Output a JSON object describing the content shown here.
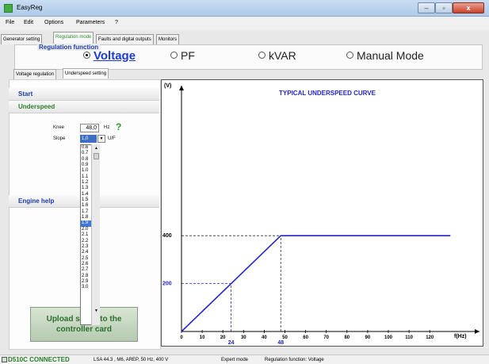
{
  "window": {
    "title": "EasyReg"
  },
  "menu": [
    "File",
    "Edit",
    "Options",
    "Parameters",
    "?"
  ],
  "main_tabs": [
    "Generator setting",
    "Regulation mode",
    "Faults and digital outputs",
    "Monitors"
  ],
  "regulation_function": {
    "title": "Regulation function",
    "options": [
      "Voltage",
      "PF",
      "kVAR",
      "Manual Mode"
    ],
    "selected": "Voltage"
  },
  "sub_tabs": [
    "Voltage regulation",
    "Underspeed setting"
  ],
  "left_pane": {
    "start": "Start",
    "underspeed": "Underspeed",
    "knee_label": "Knee",
    "knee_value": "48,0",
    "knee_unit": "Hz",
    "help_mark": "?",
    "slope_label": "Slope",
    "slope_value": "1,0",
    "slope_unit": "U/F",
    "engine_help": "Engine help",
    "upload_line1": "Upload s",
    "upload_line1_tail": "s to the",
    "upload_line2": "controller card"
  },
  "slope_options": [
    "0.6",
    "0.7",
    "0.8",
    "0.9",
    "1.0",
    "1.1",
    "1.2",
    "1.3",
    "1.4",
    "1.5",
    "1.6",
    "1.7",
    "1.8",
    "1.9",
    "2.0",
    "2.1",
    "2.2",
    "2.3",
    "2.4",
    "2.5",
    "2.6",
    "2.7",
    "2.8",
    "2.9",
    "3.0"
  ],
  "slope_highlighted": "1.9",
  "chart_data": {
    "type": "line",
    "title": "TYPICAL UNDERSPEED CURVE",
    "xlabel": "f(Hz)",
    "ylabel": "(V)",
    "xlim": [
      0,
      130
    ],
    "ylim": [
      0,
      450
    ],
    "x_ticks": [
      0,
      10,
      20,
      30,
      40,
      50,
      60,
      70,
      80,
      90,
      100,
      110,
      120
    ],
    "x_tick_labels": [
      "0",
      "10",
      "20",
      "30",
      "40",
      "50",
      "60",
      "70",
      "80",
      "90",
      "100",
      "110",
      "120"
    ],
    "y_marks": [
      400,
      200
    ],
    "x_marks": [
      24,
      48
    ],
    "series": [
      {
        "x": [
          0,
          48,
          130
        ],
        "y": [
          0,
          400,
          400
        ]
      }
    ],
    "guides": [
      {
        "from": [
          0,
          400
        ],
        "to": [
          48,
          400
        ]
      },
      {
        "from": [
          48,
          0
        ],
        "to": [
          48,
          400
        ]
      },
      {
        "from": [
          0,
          200
        ],
        "to": [
          24,
          200
        ]
      },
      {
        "from": [
          24,
          0
        ],
        "to": [
          24,
          200
        ]
      },
      {
        "from": [
          0,
          0
        ],
        "to": [
          24,
          200
        ]
      }
    ],
    "colors": {
      "curve": "#2626c8",
      "mark": "#2626c8",
      "guide": "#333333"
    }
  },
  "status": {
    "connection": "D510C CONNECTED",
    "device": "LSA 44.3 , M6, AREP, 50 Hz, 400 V",
    "mode": "Expert mode",
    "function": "Regulation function: Voltage"
  }
}
